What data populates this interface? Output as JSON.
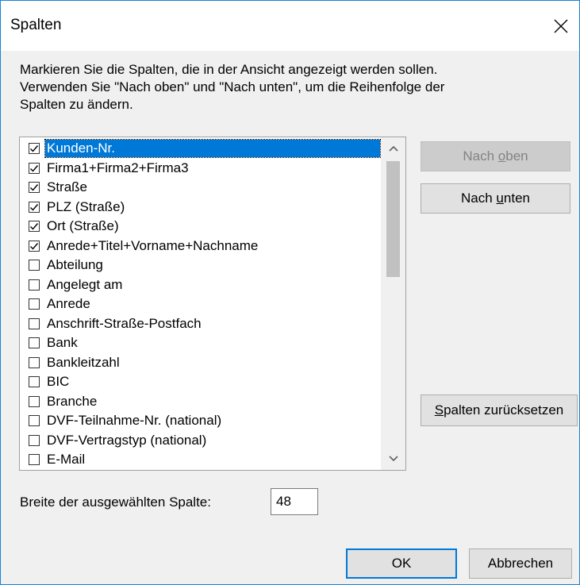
{
  "window": {
    "title": "Spalten",
    "close_icon": "close-icon"
  },
  "description": [
    "Markieren Sie die Spalten, die in der Ansicht angezeigt werden sollen.",
    "Verwenden Sie \"Nach oben\" und \"Nach unten\", um die Reihenfolge der",
    "Spalten zu ändern."
  ],
  "columns": [
    {
      "label": "Kunden-Nr.",
      "checked": true,
      "selected": true
    },
    {
      "label": "Firma1+Firma2+Firma3",
      "checked": true
    },
    {
      "label": "Straße",
      "checked": true
    },
    {
      "label": "PLZ (Straße)",
      "checked": true
    },
    {
      "label": "Ort (Straße)",
      "checked": true
    },
    {
      "label": "Anrede+Titel+Vorname+Nachname",
      "checked": true
    },
    {
      "label": "Abteilung",
      "checked": false
    },
    {
      "label": "Angelegt am",
      "checked": false
    },
    {
      "label": "Anrede",
      "checked": false
    },
    {
      "label": "Anschrift-Straße-Postfach",
      "checked": false
    },
    {
      "label": "Bank",
      "checked": false
    },
    {
      "label": "Bankleitzahl",
      "checked": false
    },
    {
      "label": "BIC",
      "checked": false
    },
    {
      "label": "Branche",
      "checked": false
    },
    {
      "label": "DVF-Teilnahme-Nr. (national)",
      "checked": false
    },
    {
      "label": "DVF-Vertragstyp (national)",
      "checked": false
    },
    {
      "label": "E-Mail",
      "checked": false
    }
  ],
  "buttons": {
    "move_up": {
      "before": "Nach ",
      "mnemonic": "o",
      "after": "ben",
      "enabled": false
    },
    "move_down": {
      "before": "Nach ",
      "mnemonic": "u",
      "after": "nten",
      "enabled": true
    },
    "reset": {
      "before": "",
      "mnemonic": "S",
      "after": "palten zurücksetzen"
    },
    "ok": "OK",
    "cancel": "Abbrechen"
  },
  "column_width": {
    "label": "Breite der ausgewählten Spalte:",
    "value": "48"
  },
  "colors": {
    "selection": "#0078d7",
    "window_border": "#1883d7",
    "default_button_border": "#0078d7"
  }
}
